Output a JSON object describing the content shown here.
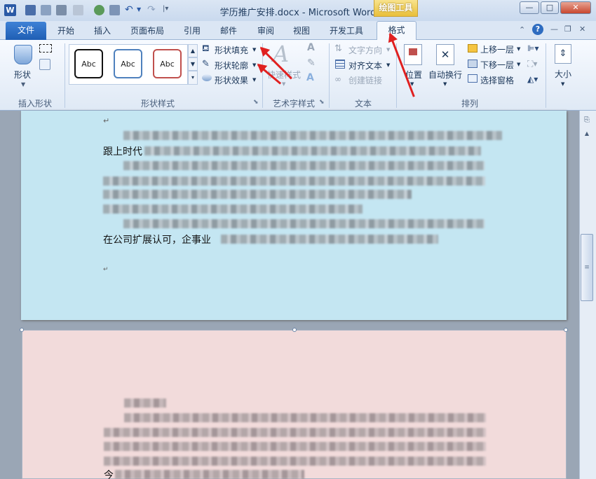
{
  "window": {
    "title": "学历推广安排.docx - Microsoft Word",
    "context_tab_group": "绘图工具",
    "app_icon": "W",
    "buttons": {
      "minimize": "—",
      "maximize": "□",
      "close": "✕"
    }
  },
  "tabs": [
    {
      "label": "文件"
    },
    {
      "label": "开始"
    },
    {
      "label": "插入"
    },
    {
      "label": "页面布局"
    },
    {
      "label": "引用"
    },
    {
      "label": "邮件"
    },
    {
      "label": "审阅"
    },
    {
      "label": "视图"
    },
    {
      "label": "开发工具"
    },
    {
      "label": "格式"
    }
  ],
  "ribbon": {
    "insert_shapes": {
      "shapes_label": "形状",
      "group_label": "插入形状"
    },
    "shape_styles": {
      "abc_samples": [
        "Abc",
        "Abc",
        "Abc"
      ],
      "fill_label": "形状填充",
      "outline_label": "形状轮廓",
      "effects_label": "形状效果",
      "group_label": "形状样式"
    },
    "wordart": {
      "quick_styles_label": "快速样式",
      "group_label": "艺术字样式"
    },
    "text": {
      "direction_label": "文字方向",
      "align_label": "对齐文本",
      "link_label": "创建链接",
      "group_label": "文本"
    },
    "arrange": {
      "position_label": "位置",
      "wrap_label": "自动换行",
      "bring_forward_label": "上移一层",
      "send_backward_label": "下移一层",
      "selection_pane_label": "选择窗格",
      "group_label": "排列"
    },
    "size": {
      "size_label": "大小"
    }
  },
  "document": {
    "page1_visible_text": [
      "跟上时代",
      "在公司扩展认可，企事业"
    ],
    "page2_visible_text": [
      "今"
    ]
  },
  "colors": {
    "page1_bg": "#c4e6f2",
    "page2_bg": "#f2dbdb",
    "annotation_arrow": "#e02020",
    "context_tab": "#e9bf3a"
  }
}
